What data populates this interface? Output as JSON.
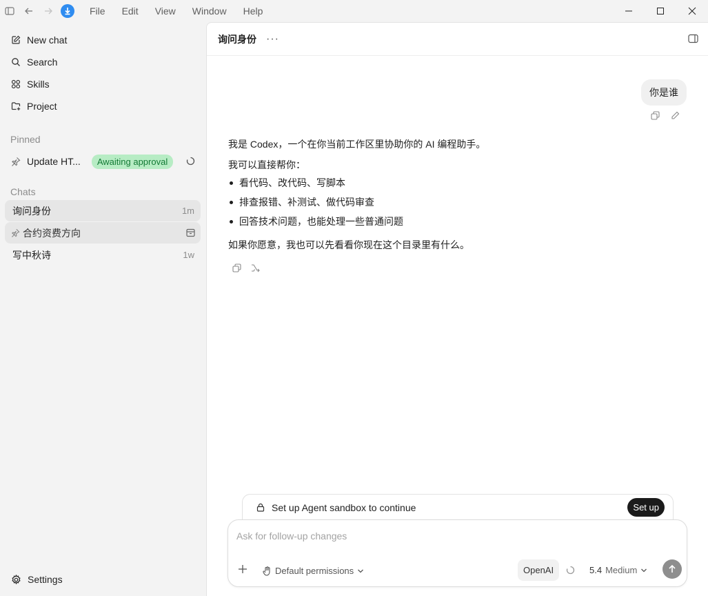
{
  "menu": [
    "File",
    "Edit",
    "View",
    "Window",
    "Help"
  ],
  "sidebar": {
    "nav": [
      {
        "label": "New chat",
        "icon": "edit-icon"
      },
      {
        "label": "Search",
        "icon": "search-icon"
      },
      {
        "label": "Skills",
        "icon": "grid-icon"
      },
      {
        "label": "Project",
        "icon": "folder-add-icon"
      }
    ],
    "pinned_label": "Pinned",
    "pinned_item": {
      "label": "Update HT...",
      "badge": "Awaiting approval"
    },
    "chats_label": "Chats",
    "chats": [
      {
        "label": "询问身份",
        "time": "1m"
      },
      {
        "label": "合约资费方向",
        "time": ""
      },
      {
        "label": "写中秋诗",
        "time": "1w"
      }
    ],
    "settings_label": "Settings"
  },
  "main": {
    "title": "询问身份",
    "user_message": "你是谁",
    "assistant": {
      "intro": "我是 Codex，一个在你当前工作区里协助你的 AI 编程助手。",
      "lead": "我可以直接帮你：",
      "bullets": [
        "看代码、改代码、写脚本",
        "排查报错、补测试、做代码审查",
        "回答技术问题，也能处理一些普通问题"
      ],
      "closing": "如果你愿意，我也可以先看看你现在这个目录里有什么。"
    },
    "sandbox": {
      "text": "Set up Agent sandbox to continue",
      "button": "Set up"
    },
    "composer": {
      "placeholder": "Ask for follow-up changes",
      "permissions": "Default permissions",
      "provider": "OpenAI",
      "model": "5.4",
      "effort": "Medium"
    }
  },
  "colors": {
    "accent": "#2f8cf0",
    "badge_bg": "#b7ecc4",
    "badge_text": "#137a35"
  }
}
